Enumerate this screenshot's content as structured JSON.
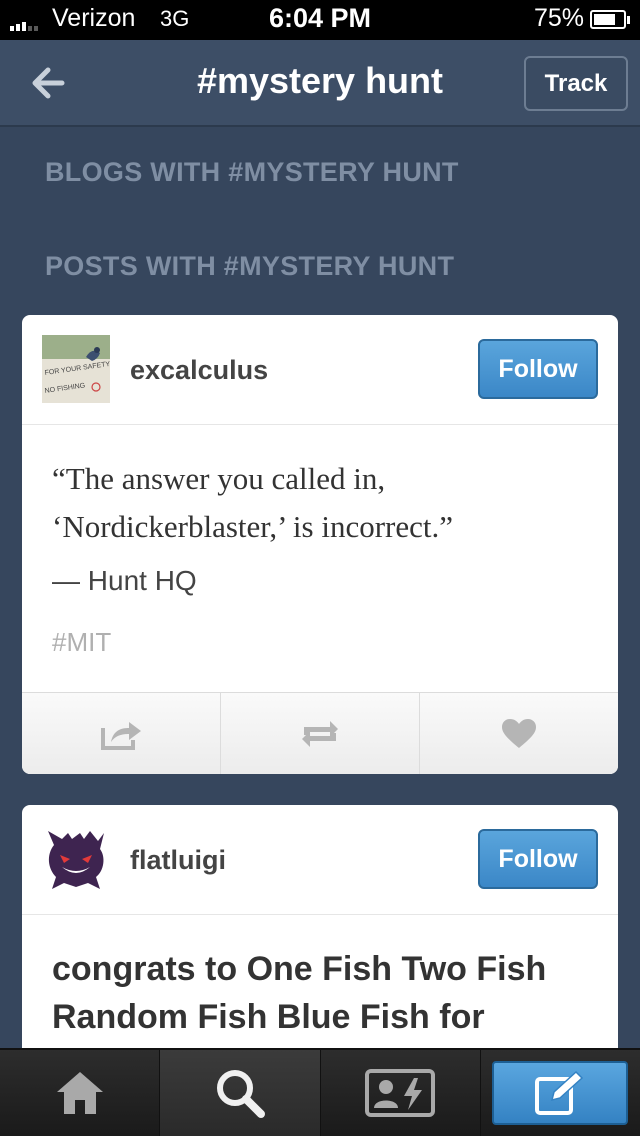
{
  "status_bar": {
    "carrier": "Verizon",
    "network": "3G",
    "time": "6:04 PM",
    "battery": "75%",
    "battery_level": 0.75
  },
  "nav": {
    "title": "#mystery hunt",
    "track_label": "Track",
    "back_icon": "back-arrow-icon"
  },
  "sections": {
    "blogs_heading": "BLOGS WITH #MYSTERY HUNT",
    "posts_heading": "POSTS WITH #MYSTERY HUNT"
  },
  "posts": [
    {
      "username": "excalculus",
      "follow_label": "Follow",
      "avatar_sign_text": [
        "FOR YOUR SAFETY",
        "NO FISHING"
      ],
      "quote_lines": [
        "“The answer you called in,",
        "‘Nordickerblaster,’ is incorrect.”"
      ],
      "attribution": "— Hunt HQ",
      "tag": "#MIT",
      "actions": [
        "share-icon",
        "reblog-icon",
        "heart-icon"
      ]
    },
    {
      "username": "flatluigi",
      "follow_label": "Follow",
      "text_lines": [
        "congrats to One Fish Two Fish",
        "Random Fish Blue Fish for"
      ]
    }
  ],
  "tab_bar": [
    "home-icon",
    "search-icon",
    "activity-icon",
    "compose-icon"
  ],
  "colors": {
    "background": "#36465d",
    "follow_blue": "#3b87c7"
  }
}
